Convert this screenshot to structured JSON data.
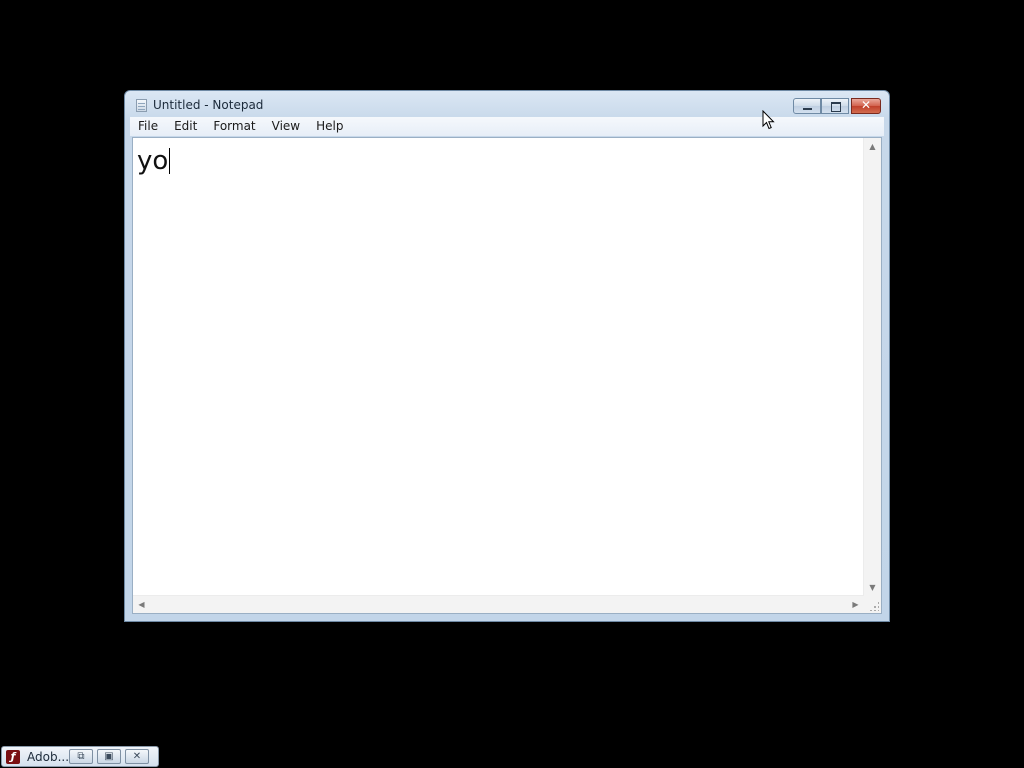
{
  "window": {
    "title": "Untitled - Notepad",
    "app_icon": "notepad-icon",
    "caption_buttons": {
      "minimize_icon": "minimize-icon",
      "maximize_icon": "maximize-icon",
      "close_icon": "close-icon",
      "close_color": "#c7432c"
    }
  },
  "menubar": {
    "items": [
      "File",
      "Edit",
      "Format",
      "View",
      "Help"
    ]
  },
  "editor": {
    "content": "yo"
  },
  "taskbar": {
    "item": {
      "label": "Adob...",
      "icon": "adobe-flash-icon",
      "icon_color": "#7a0f12",
      "buttons": [
        "restore-icon",
        "maximize-icon",
        "close-icon"
      ]
    }
  },
  "colors": {
    "desktop_background": "#000000",
    "window_frame": "#c2d5e9"
  }
}
